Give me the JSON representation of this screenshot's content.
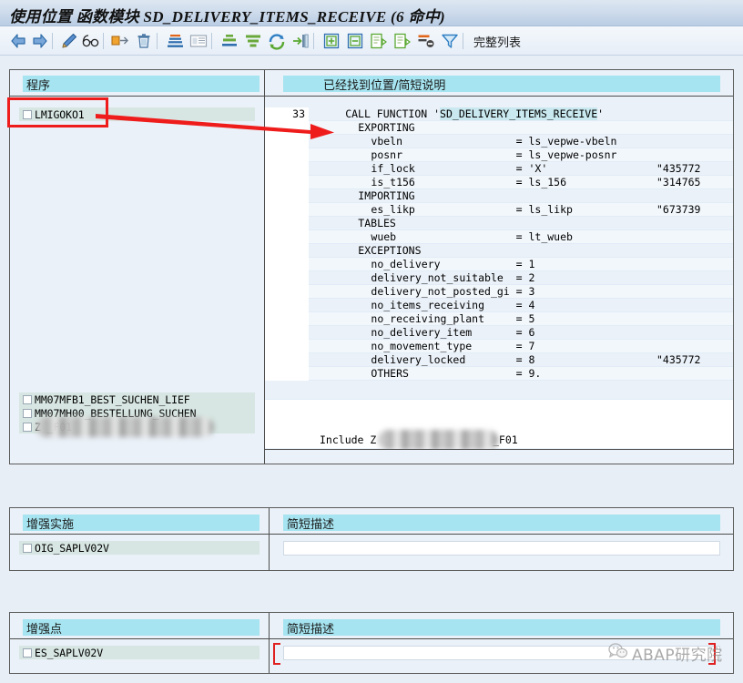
{
  "window": {
    "title": "使用位置 函数模块 SD_DELIVERY_ITEMS_RECEIVE (6 命中)"
  },
  "toolbar": {
    "items": [
      {
        "name": "back-icon",
        "tooltip": "后退"
      },
      {
        "name": "forward-icon",
        "tooltip": "前进"
      },
      {
        "name": "edit-pencil-icon",
        "tooltip": "修改"
      },
      {
        "name": "display-glasses-icon",
        "tooltip": "显示"
      },
      {
        "name": "export-icon",
        "tooltip": "导出"
      },
      {
        "name": "delete-trash-icon",
        "tooltip": "删除"
      },
      {
        "name": "sort-ascending-icon",
        "tooltip": "升序排序"
      },
      {
        "name": "details-list-icon",
        "tooltip": "明细"
      },
      {
        "name": "sum-total-icon",
        "tooltip": "合计"
      },
      {
        "name": "filter-icon",
        "tooltip": "过滤"
      },
      {
        "name": "refresh-icon",
        "tooltip": "刷新"
      },
      {
        "name": "next-hit-icon",
        "tooltip": "下一个"
      },
      {
        "name": "expand-all-icon",
        "tooltip": "全部展开"
      },
      {
        "name": "collapse-all-icon",
        "tooltip": "全部折叠"
      },
      {
        "name": "worklist-icon",
        "tooltip": "工作清单"
      },
      {
        "name": "document-icon",
        "tooltip": "文档"
      },
      {
        "name": "delete-filter-icon",
        "tooltip": "删除过滤"
      },
      {
        "name": "set-filter-icon",
        "tooltip": "设置过滤"
      }
    ],
    "full_list_label": "完整列表"
  },
  "results": {
    "headers": {
      "program": "程序",
      "hit_location": "已经找到位置/简短说明"
    },
    "programs": [
      {
        "label": "LMIGOKO1",
        "checked": false,
        "redacted": false,
        "highlighted": true
      },
      {
        "label": "MM07MFB1_BEST_SUCHEN_LIEF",
        "checked": false,
        "redacted": false,
        "highlighted": false
      },
      {
        "label": "MM07MH00_BESTELLUNG_SUCHEN",
        "checked": false,
        "redacted": false,
        "highlighted": false
      },
      {
        "label": "Z                      _F01",
        "checked": false,
        "redacted": true,
        "highlighted": false
      }
    ],
    "code_lines": [
      {
        "lineno": "33",
        "indent": 4,
        "text": "CALL FUNCTION '",
        "highlight": "SD_DELIVERY_ITEMS_RECEIVE",
        "suffix": "'",
        "comment": ""
      },
      {
        "lineno": "",
        "indent": 6,
        "text": "EXPORTING",
        "comment": ""
      },
      {
        "lineno": "",
        "indent": 8,
        "text": "vbeln                  = ls_vepwe-vbeln",
        "comment": ""
      },
      {
        "lineno": "",
        "indent": 8,
        "text": "posnr                  = ls_vepwe-posnr",
        "comment": ""
      },
      {
        "lineno": "",
        "indent": 8,
        "text": "if_lock                = 'X'",
        "comment": "\"435772"
      },
      {
        "lineno": "",
        "indent": 8,
        "text": "is_t156                = ls_156",
        "comment": "\"314765"
      },
      {
        "lineno": "",
        "indent": 6,
        "text": "IMPORTING",
        "comment": ""
      },
      {
        "lineno": "",
        "indent": 8,
        "text": "es_likp                = ls_likp",
        "comment": "\"673739"
      },
      {
        "lineno": "",
        "indent": 6,
        "text": "TABLES",
        "comment": ""
      },
      {
        "lineno": "",
        "indent": 8,
        "text": "wueb                   = lt_wueb",
        "comment": ""
      },
      {
        "lineno": "",
        "indent": 6,
        "text": "EXCEPTIONS",
        "comment": ""
      },
      {
        "lineno": "",
        "indent": 8,
        "text": "no_delivery            = 1",
        "comment": ""
      },
      {
        "lineno": "",
        "indent": 8,
        "text": "delivery_not_suitable  = 2",
        "comment": ""
      },
      {
        "lineno": "",
        "indent": 8,
        "text": "delivery_not_posted_gi = 3",
        "comment": ""
      },
      {
        "lineno": "",
        "indent": 8,
        "text": "no_items_receiving     = 4",
        "comment": ""
      },
      {
        "lineno": "",
        "indent": 8,
        "text": "no_receiving_plant     = 5",
        "comment": ""
      },
      {
        "lineno": "",
        "indent": 8,
        "text": "no_delivery_item       = 6",
        "comment": ""
      },
      {
        "lineno": "",
        "indent": 8,
        "text": "no_movement_type       = 7",
        "comment": ""
      },
      {
        "lineno": "",
        "indent": 8,
        "text": "delivery_locked        = 8",
        "comment": "\"435772"
      },
      {
        "lineno": "",
        "indent": 8,
        "text": "OTHERS                 = 9.",
        "comment": ""
      }
    ],
    "include_line": {
      "prefix": "Include Z",
      "redacted_middle": true,
      "suffix": "_F01"
    }
  },
  "enhancement_implementation": {
    "headers": {
      "name": "增强实施",
      "description": "简短描述"
    },
    "rows": [
      {
        "name": "OIG_SAPLV02V",
        "description": "",
        "checked": false
      }
    ]
  },
  "enhancement_spot": {
    "headers": {
      "name": "增强点",
      "description": "简短描述"
    },
    "rows": [
      {
        "name": "ES_SAPLV02V",
        "description": "",
        "checked": false
      }
    ]
  },
  "annotations": {
    "highlight_box_target": "LMIGOKO1",
    "arrow_target": "EXPORTING",
    "bracket_target": "ES_SAPLV02V-description"
  },
  "watermark": {
    "text": "ABAP研究院",
    "icon": "wechat-icon"
  },
  "colors": {
    "header_cyan": "#a5e4f0",
    "row_teal": "#d7e6e2",
    "annotation_red": "#ef1c1c",
    "panel_border": "#5a5a5a",
    "page_bg": "#e8eef5"
  }
}
